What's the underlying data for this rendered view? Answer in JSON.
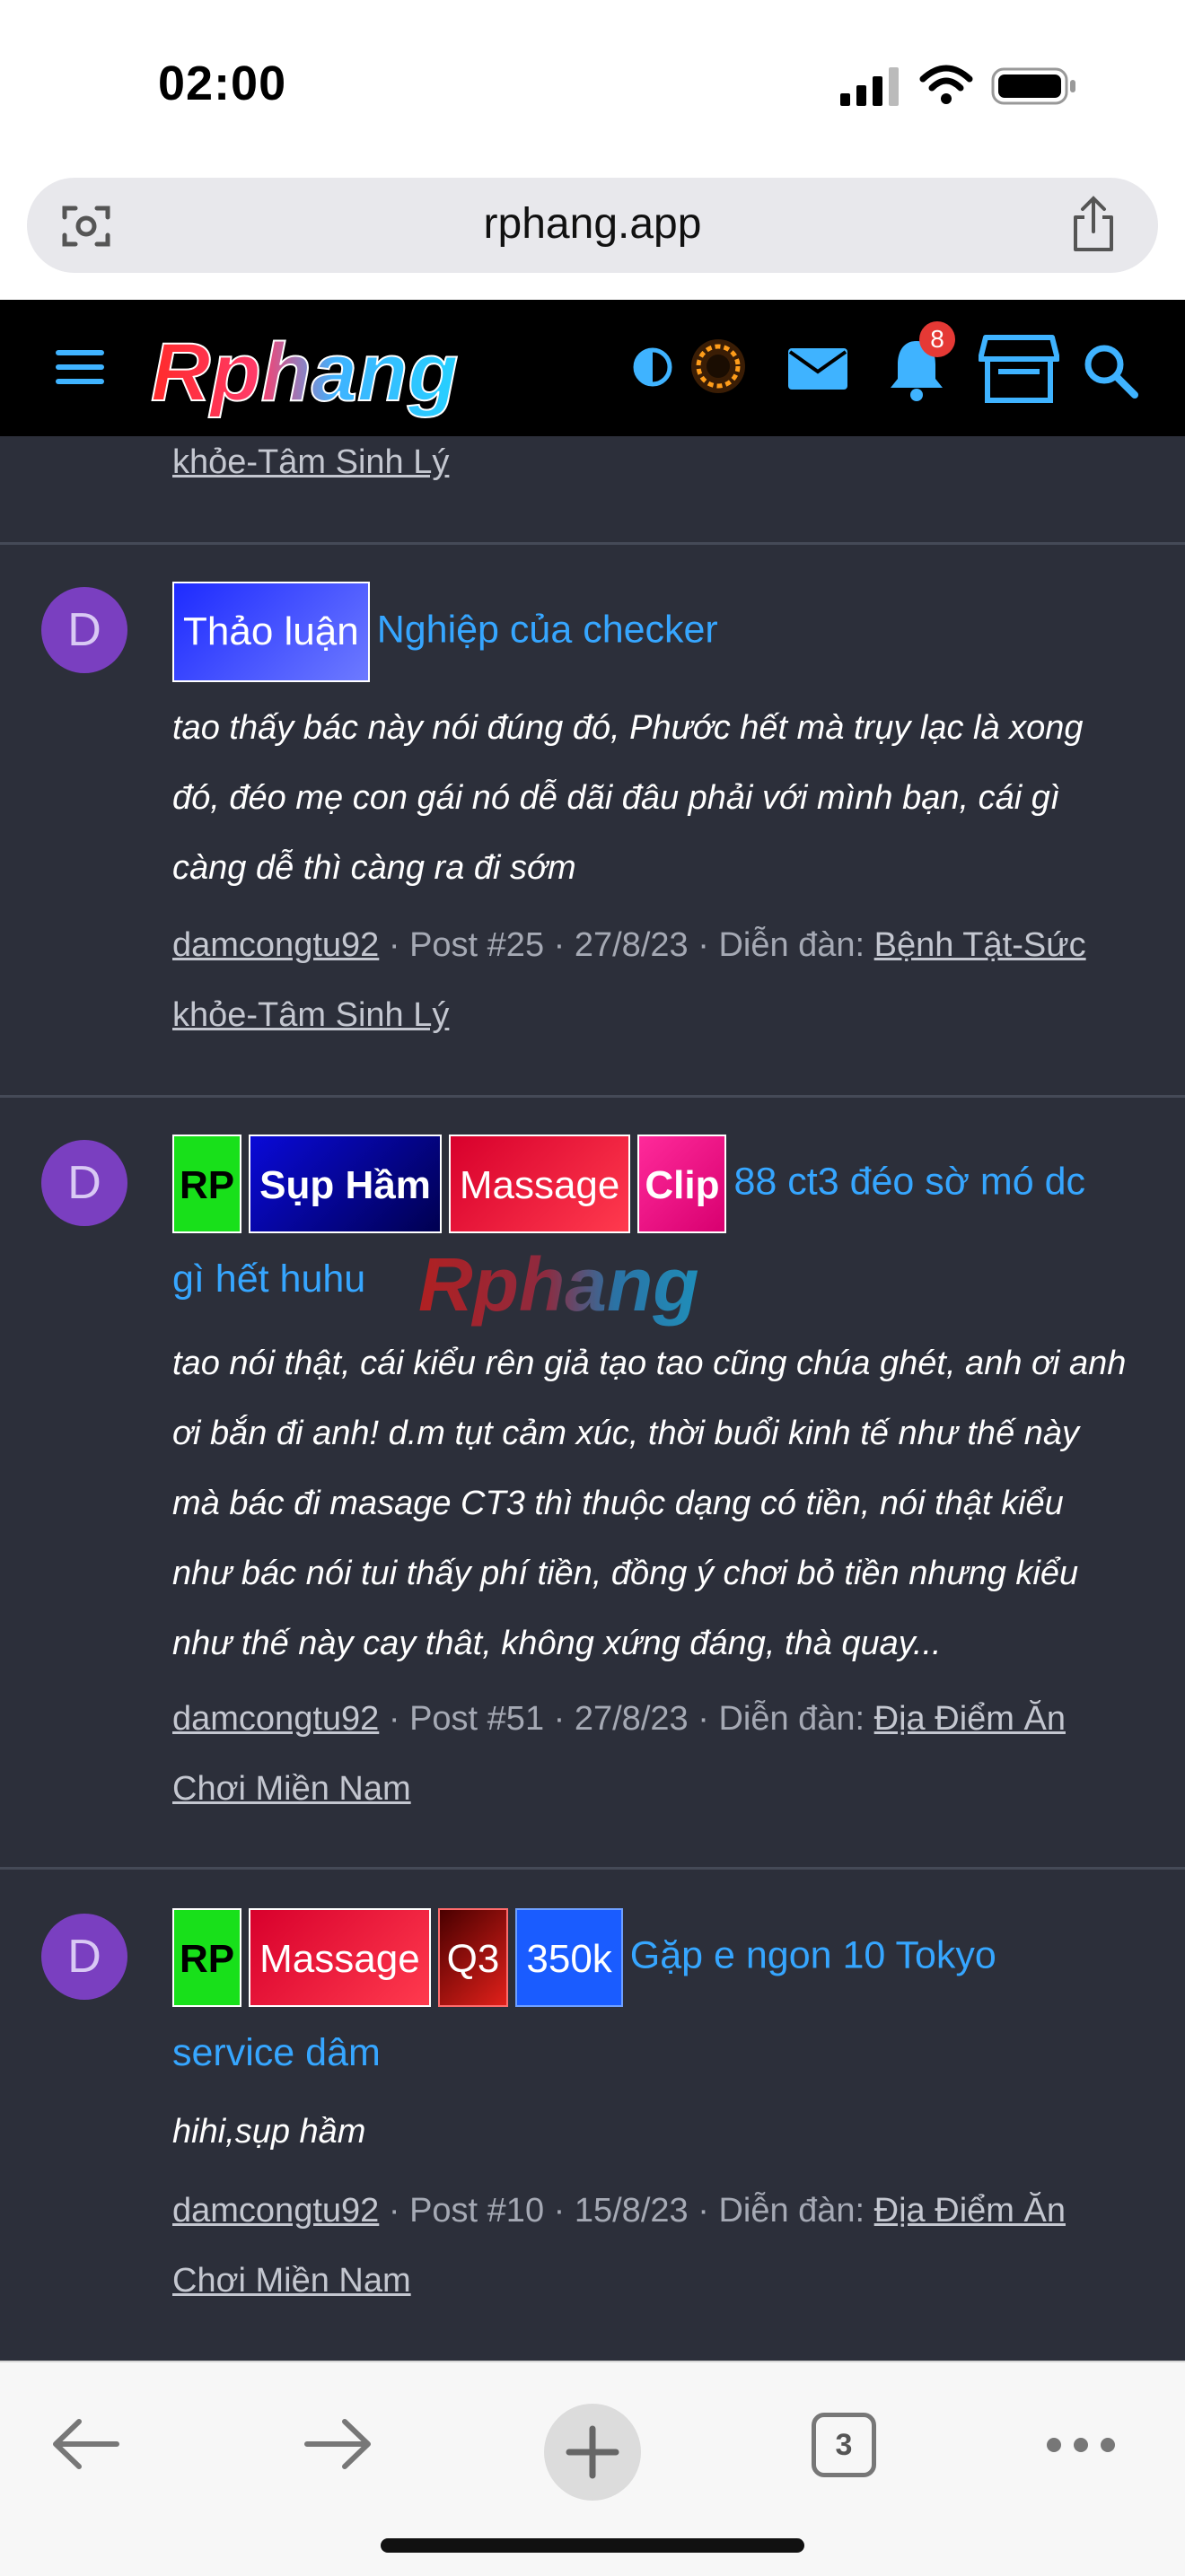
{
  "status": {
    "time": "02:00"
  },
  "browser": {
    "url": "rphang.app",
    "tab_count": "3"
  },
  "site": {
    "logo_text": "Rphang",
    "notification_count": "8"
  },
  "top_fragment": {
    "forum_link_cont": "khỏe-Tâm Sinh Lý"
  },
  "posts": [
    {
      "avatar_letter": "D",
      "tags": [
        {
          "label": "Thảo luận"
        }
      ],
      "title_part1": "Nghiệp của checker",
      "title_part2": "",
      "excerpt_lines": [
        "tao thấy bác này nói đúng đó, Phước hết mà trụy lạc là xong",
        "đó, đéo mẹ con gái nó dễ dãi đâu phải với mình bạn, cái gì",
        "càng dễ thì càng ra đi sớm"
      ],
      "author": "damcongtu92",
      "post_no": "Post #25",
      "date": "27/8/23",
      "forum_label": "Diễn đàn:",
      "forum_line1": "Bệnh Tật-Sức",
      "forum_line2": "khỏe-Tâm Sinh Lý"
    },
    {
      "avatar_letter": "D",
      "tags": [
        {
          "label": "RP"
        },
        {
          "label": "Sụp Hầm"
        },
        {
          "label": "Massage"
        },
        {
          "label": "Clip"
        }
      ],
      "title_part1": "88 ct3 đéo sờ mó dc",
      "title_part2": "gì hết huhu",
      "excerpt_lines": [
        "tao nói thật, cái kiểu rên giả tạo tao cũng chúa ghét, anh ơi anh",
        "ơi bắn đi anh! d.m tụt cảm xúc, thời buổi kinh tế như thế này",
        "mà bác đi masage CT3 thì thuộc dạng có tiền, nói thật kiểu",
        "như bác nói tui thấy phí tiền, đồng ý chơi bỏ tiền nhưng kiểu",
        "như thế này cay thât, không xứng đáng, thà quay..."
      ],
      "author": "damcongtu92",
      "post_no": "Post #51",
      "date": "27/8/23",
      "forum_label": "Diễn đàn:",
      "forum_line1": "Địa Điểm Ăn",
      "forum_line2": "Chơi Miền Nam"
    },
    {
      "avatar_letter": "D",
      "tags": [
        {
          "label": "RP"
        },
        {
          "label": "Massage"
        },
        {
          "label": "Q3"
        },
        {
          "label": "350k"
        }
      ],
      "title_part1": "Gặp e ngon 10 Tokyo",
      "title_part2": "service dâm",
      "excerpt_lines": [
        "hihi,sụp hầm"
      ],
      "author": "damcongtu92",
      "post_no": "Post #10",
      "date": "15/8/23",
      "forum_label": "Diễn đàn:",
      "forum_line1": "Địa Điểm Ăn",
      "forum_line2": "Chơi Miền Nam"
    }
  ],
  "colors": {
    "link": "#36a6ff",
    "background": "#2c2f3a",
    "header": "#000000"
  }
}
